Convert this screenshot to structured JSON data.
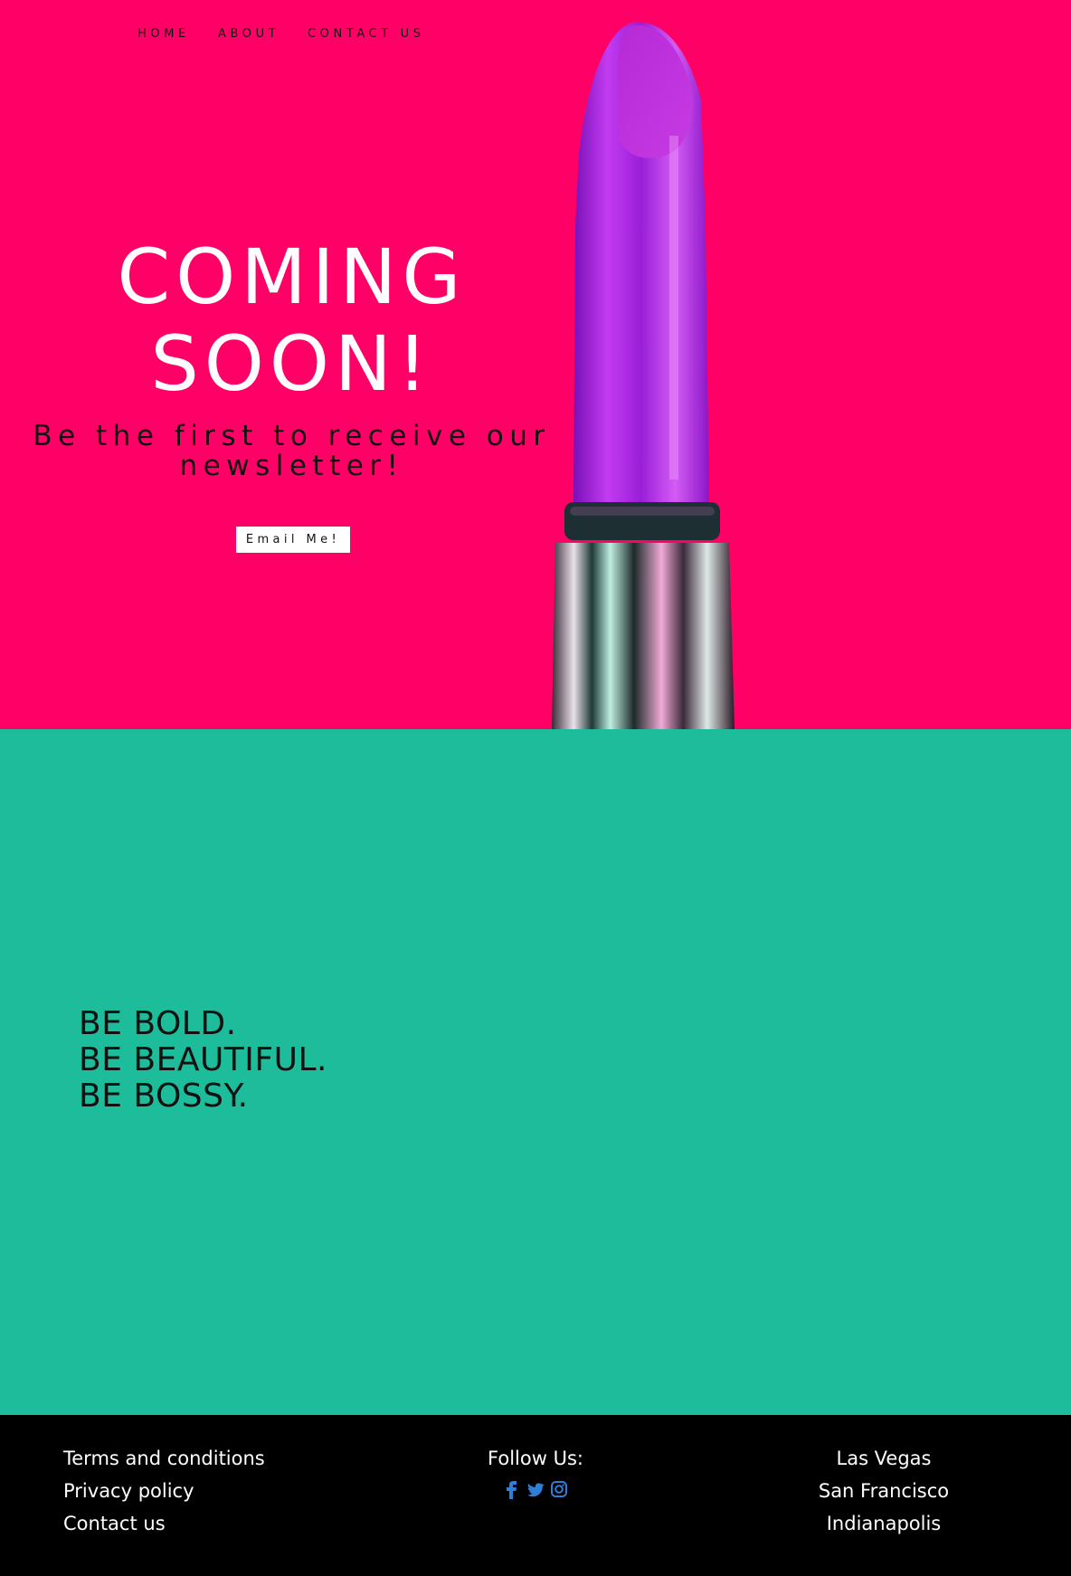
{
  "nav": {
    "home": "HOME",
    "about": "ABOUT",
    "contact": "CONTACT US"
  },
  "hero": {
    "title_line1": "COMING",
    "title_line2": "SOON!",
    "subtitle": "Be the first to receive our newsletter!",
    "button_label": "Email Me!",
    "background": "#ff0066"
  },
  "tagline": {
    "line1": "BE BOLD.",
    "line2": "BE BEAUTIFUL.",
    "line3": "BE BOSSY.",
    "background": "#1dbd9c"
  },
  "footer": {
    "links": [
      "Terms and conditions",
      "Privacy policy",
      "Contact us"
    ],
    "follow_label": "Follow Us:",
    "social_icons": [
      "facebook-icon",
      "twitter-icon",
      "instagram-icon"
    ],
    "social_color": "#2f7fd6",
    "cities": [
      "Las Vegas",
      "San Francisco",
      "Indianapolis"
    ]
  }
}
